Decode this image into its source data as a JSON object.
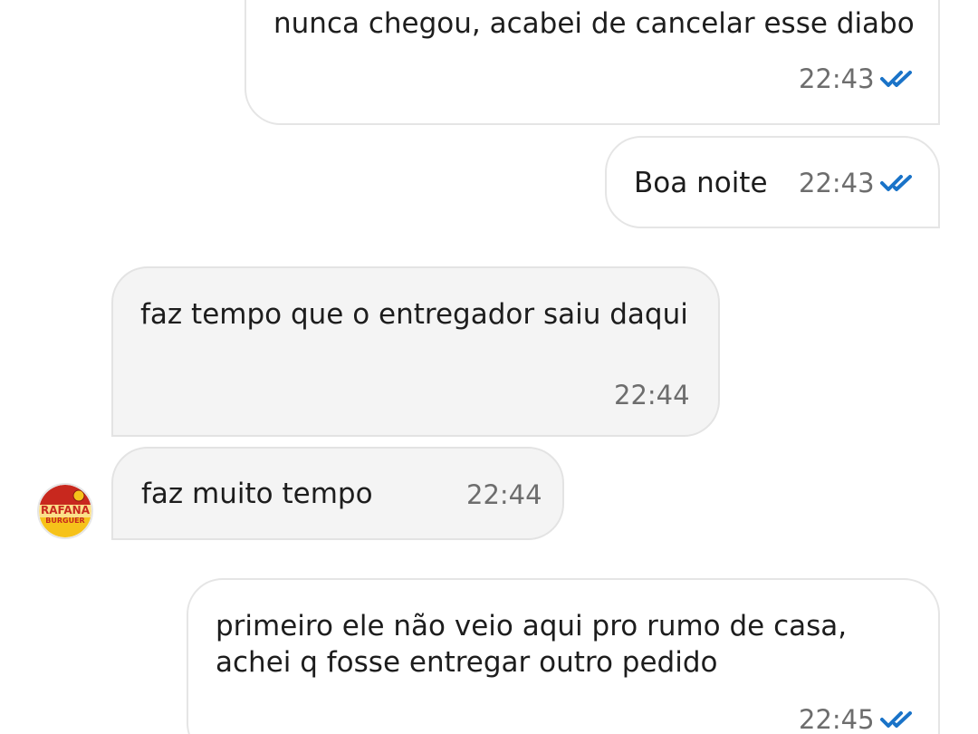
{
  "messages": [
    {
      "direction": "outgoing",
      "text": "nunca chegou, acabei de cancelar esse diabo",
      "time": "22:43",
      "status": "read"
    },
    {
      "direction": "outgoing",
      "text": "Boa noite",
      "time": "22:43",
      "status": "read"
    },
    {
      "direction": "incoming",
      "text": "faz tempo que o entregador saiu daqui",
      "time": "22:44"
    },
    {
      "direction": "incoming",
      "text": "faz muito tempo",
      "time": "22:44"
    },
    {
      "direction": "outgoing",
      "lines": [
        "primeiro ele não veio aqui pro rumo de casa,",
        "achei q fosse entregar outro pedido"
      ],
      "time": "22:45",
      "status": "read"
    }
  ],
  "sender": {
    "avatar_icon": "rafana-burguer-logo-icon",
    "avatar_logo_lines": [
      "RAFANA",
      "BURGUER"
    ]
  },
  "colors": {
    "read_check": "#1a73c8",
    "outgoing_bubble": "#ffffff",
    "incoming_bubble": "#f4f4f4",
    "bubble_border": "#e5e5e5",
    "time_text": "#6d6d6d"
  }
}
